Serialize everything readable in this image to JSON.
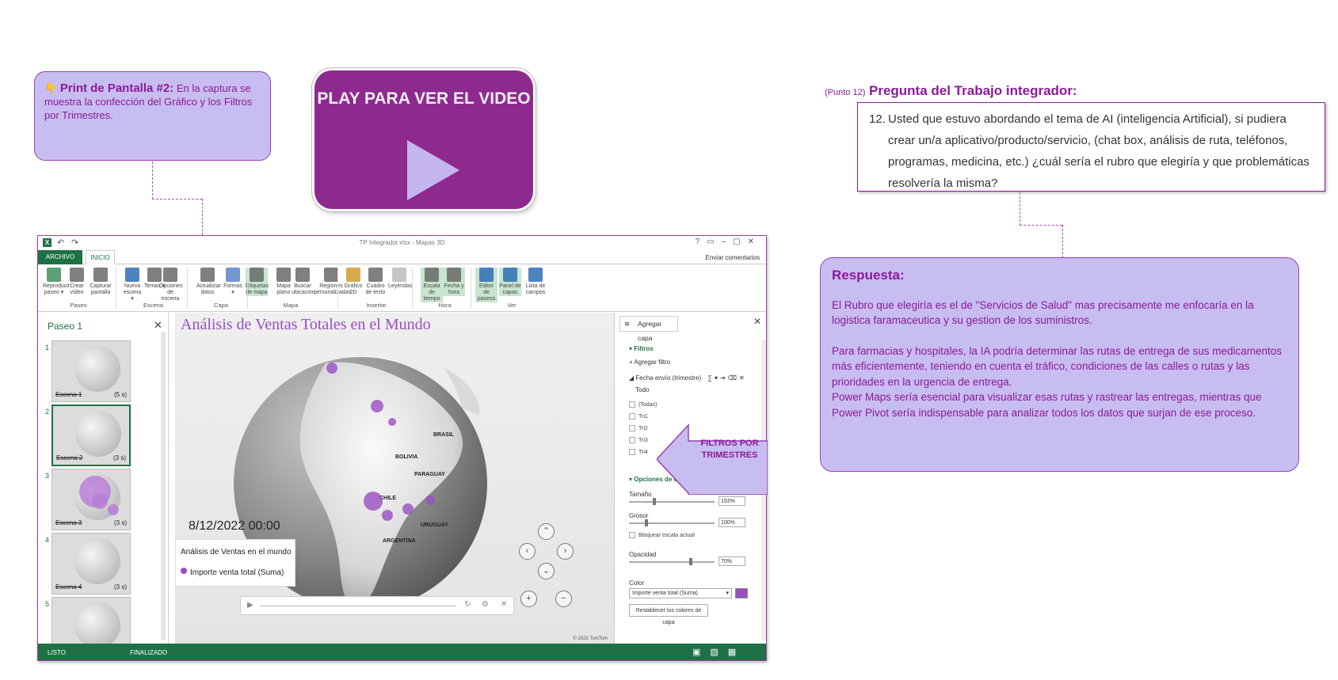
{
  "print_callout": {
    "emoji": "👇",
    "title": "Print de Pantalla #2:",
    "text": "En la captura se muestra la confección del Gráfico y los Filtros por Trimestres."
  },
  "play_button": {
    "label": "PLAY PARA VER EL VIDEO"
  },
  "question": {
    "tag": "(Punto 12)",
    "title": "Pregunta del Trabajo integrador:",
    "number": "12.",
    "text": "Usted que estuvo abordando el tema de AI (inteligencia Artificial), si pudiera crear un/a aplicativo/producto/servicio, (chat box, análisis de ruta, teléfonos, programas, medicina, etc.) ¿cuál sería el rubro que elegiría y que problemáticas resolvería la misma?"
  },
  "answer": {
    "title": "Respuesta:",
    "p1": "El Rubro que elegiría es el de \"Servicios de Salud\" mas precisamente me enfocaría en la logistica faramaceutica y su gestion de los suministros.",
    "p2": "Para farmacias y hospitales, la IA podría determinar las rutas de entrega de sus medicamentos más eficientemente, teniendo en cuenta el tráfico, condiciones de las calles o rutas y las prioridades en la urgencia de entrega.",
    "p3": "Power Maps sería esencial para visualizar esas rutas y rastrear las entregas, mientras que Power Pivot sería indispensable para analizar todos los datos que surjan de ese proceso."
  },
  "filtros_callout": {
    "label": "FILTROS POR TRIMESTRES"
  },
  "app": {
    "window_title": "TP Integrador.xlsx - Mapas 3D",
    "tab_archivo": "ARCHIVO",
    "tab_inicio": "INICIO",
    "enviar_comentarios": "Enviar comentarios",
    "ribbon": [
      {
        "label": "Reproducir paseo ▾",
        "color": "#3f8f5a"
      },
      {
        "label": "Crear vídeo",
        "color": "#6a6a6a"
      },
      {
        "label": "Capturar pantalla",
        "color": "#6a6a6a"
      },
      {
        "label": "Nueva escena ▾",
        "color": "#2e6fb5"
      },
      {
        "label": "Temas ▾",
        "color": "#6a6a6a"
      },
      {
        "label": "Opciones de escena",
        "color": "#6a6a6a"
      },
      {
        "label": "Actualizar datos",
        "color": "#6a6a6a"
      },
      {
        "label": "Formas ▾",
        "color": "#5a86c5"
      },
      {
        "label": "Etiquetas de mapa",
        "color": "#6a6a6a"
      },
      {
        "label": "Mapa plano",
        "color": "#6a6a6a"
      },
      {
        "label": "Buscar ubicación",
        "color": "#6a6a6a"
      },
      {
        "label": "Regiones personalizadas",
        "color": "#6a6a6a"
      },
      {
        "label": "Gráfico 2D",
        "color": "#d19a2e"
      },
      {
        "label": "Cuadro de texto",
        "color": "#6a6a6a"
      },
      {
        "label": "Leyendas",
        "color": "#bbbbbb"
      },
      {
        "label": "Escala de tiempo",
        "color": "#6a6a6a"
      },
      {
        "label": "Fecha y hora",
        "color": "#6a6a6a"
      },
      {
        "label": "Editor de paseos",
        "color": "#2e6fb5"
      },
      {
        "label": "Panel de capas",
        "color": "#2e6fb5"
      },
      {
        "label": "Lista de campos",
        "color": "#2e6fb5"
      }
    ],
    "groups": [
      "Paseo",
      "Escena",
      "Capa",
      "Mapa",
      "Insertar",
      "Hora",
      "Ver"
    ],
    "left_pane": {
      "title": "Paseo 1",
      "scenes": [
        {
          "num": "1",
          "label": "Escena 1",
          "dur": "(5 s)"
        },
        {
          "num": "2",
          "label": "Escena 2",
          "dur": "(3 s)"
        },
        {
          "num": "3",
          "label": "Escena 3",
          "dur": "(3 s)"
        },
        {
          "num": "4",
          "label": "Escena 4",
          "dur": "(3 s)"
        },
        {
          "num": "5",
          "label": "",
          "dur": ""
        }
      ]
    },
    "map": {
      "title": "Análisis de Ventas Totales en el Mundo",
      "date": "8/12/2022 00:00",
      "legend_title": "Análisis de Ventas en el mundo",
      "legend_series": "Importe venta total (Suma)",
      "countries": [
        "BRASIL",
        "BOLIVIA",
        "PARAGUAY",
        "CHILE",
        "URUGUAY",
        "ARGENTINA"
      ],
      "copyright": "© 2023 TomTom"
    },
    "right_pane": {
      "add_layer": "Agregar capa",
      "filters_section": "Filtros",
      "add_filter": "Agregar filtro",
      "field": "Fecha envío (trimestre)",
      "all": "Todo",
      "checkboxes": [
        "(Todas)",
        "Tri1",
        "Tri2",
        "Tri3",
        "Tri4"
      ],
      "layer_options": "Opciones de capa",
      "size_label": "Tamaño",
      "size_value": "153%",
      "thickness_label": "Grosor",
      "thickness_value": "100%",
      "lock_scale": "Bloquear escala actual",
      "opacity_label": "Opacidad",
      "opacity_value": "70%",
      "color_label": "Color",
      "color_series": "Importe venta total (Suma)",
      "color_swatch": "#9a4ec2",
      "reset_colors": "Restablecer los colores de capa"
    },
    "status": {
      "left": "LISTO",
      "middle": "FINALIZADO"
    }
  }
}
